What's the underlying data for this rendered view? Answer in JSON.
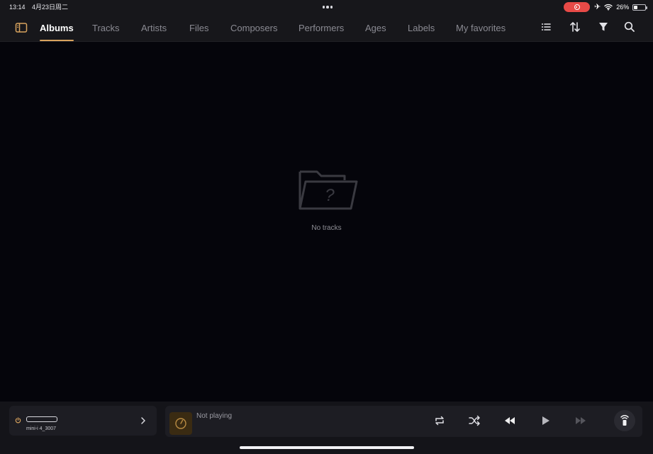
{
  "status_bar": {
    "time": "13:14",
    "date": "4月23日周二",
    "battery": "26%",
    "icons": [
      "multitask-dots-icon",
      "screen-record-icon",
      "airplane-icon",
      "wifi-icon",
      "battery-icon"
    ]
  },
  "nav": {
    "tabs": [
      {
        "label": "Albums",
        "active": true
      },
      {
        "label": "Tracks"
      },
      {
        "label": "Artists"
      },
      {
        "label": "Files"
      },
      {
        "label": "Composers"
      },
      {
        "label": "Performers"
      },
      {
        "label": "Ages"
      },
      {
        "label": "Labels"
      },
      {
        "label": "My favorites"
      }
    ],
    "icons": [
      "sidebar-toggle-icon",
      "list-view-icon",
      "sort-icon",
      "filter-icon",
      "search-icon"
    ]
  },
  "empty_state": {
    "label": "No tracks",
    "icon": "missing-folder-icon"
  },
  "player": {
    "device_name": "mini-i 4_3007",
    "now_playing": "Not playing",
    "controls": [
      "repeat-icon",
      "shuffle-icon",
      "previous-icon",
      "play-icon",
      "next-icon",
      "remote-icon"
    ]
  },
  "colors": {
    "accent": "#d8a35e",
    "record": "#e84a47",
    "background": "#05050b",
    "panel": "#17171b"
  }
}
